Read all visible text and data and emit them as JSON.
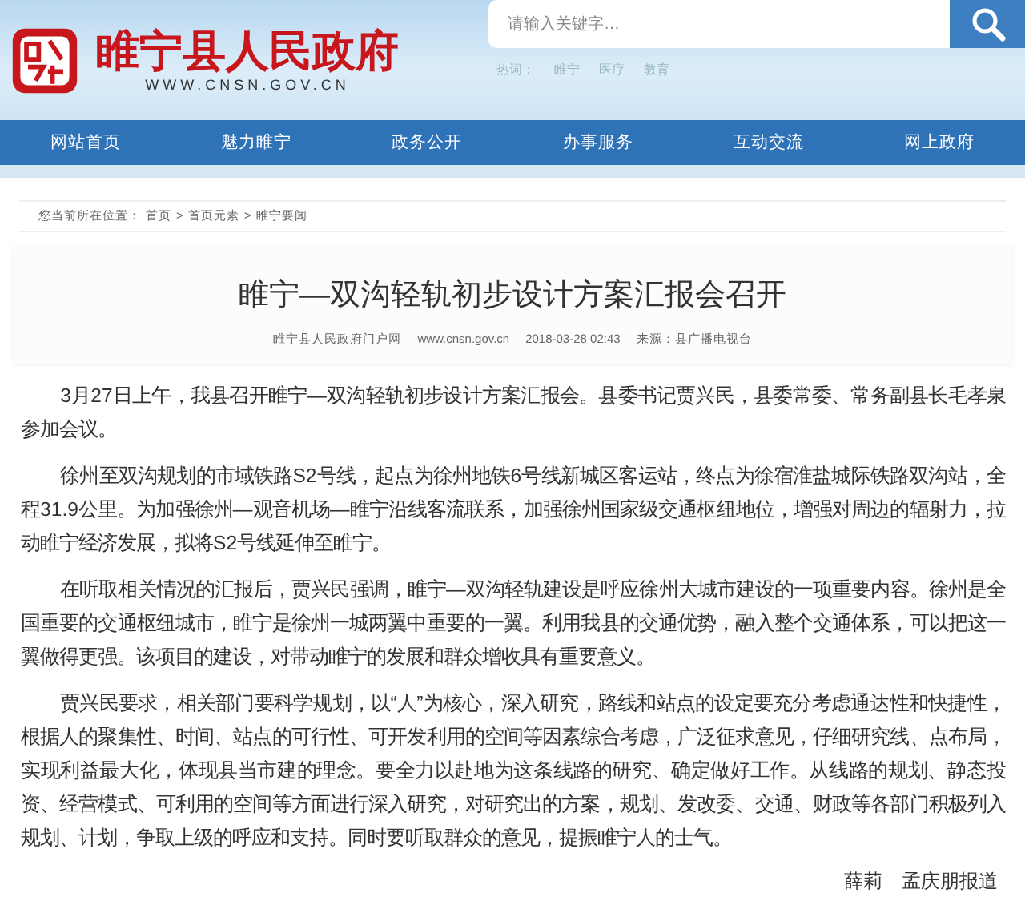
{
  "header": {
    "site_name": "睢宁县人民政府",
    "site_url": "WWW.CNSN.GOV.CN",
    "search": {
      "placeholder": "请输入关键字…"
    },
    "hot_words": {
      "label": "热词：",
      "items": [
        "睢宁",
        "医疗",
        "教育"
      ]
    }
  },
  "nav": [
    {
      "label": "网站首页"
    },
    {
      "label": "魅力睢宁"
    },
    {
      "label": "政务公开"
    },
    {
      "label": "办事服务"
    },
    {
      "label": "互动交流"
    },
    {
      "label": "网上政府"
    }
  ],
  "breadcrumb": {
    "label": "您当前所在位置：",
    "items": [
      "首页",
      "首页元素",
      "睢宁要闻"
    ],
    "separator": ">"
  },
  "article": {
    "title": "睢宁—双沟轻轨初步设计方案汇报会召开",
    "meta": [
      "睢宁县人民政府门户网",
      "www.cnsn.gov.cn",
      "2018-03-28 02:43",
      "来源：县广播电视台"
    ],
    "paragraphs": [
      "3月27日上午，我县召开睢宁—双沟轻轨初步设计方案汇报会。县委书记贾兴民，县委常委、常务副县长毛孝泉参加会议。",
      "徐州至双沟规划的市域铁路S2号线，起点为徐州地铁6号线新城区客运站，终点为徐宿淮盐城际铁路双沟站，全程31.9公里。为加强徐州—观音机场—睢宁沿线客流联系，加强徐州国家级交通枢纽地位，增强对周边的辐射力，拉动睢宁经济发展，拟将S2号线延伸至睢宁。",
      "在听取相关情况的汇报后，贾兴民强调，睢宁—双沟轻轨建设是呼应徐州大城市建设的一项重要内容。徐州是全国重要的交通枢纽城市，睢宁是徐州一城两翼中重要的一翼。利用我县的交通优势，融入整个交通体系，可以把这一翼做得更强。该项目的建设，对带动睢宁的发展和群众增收具有重要意义。",
      "贾兴民要求，相关部门要科学规划，以“人”为核心，深入研究，路线和站点的设定要充分考虑通达性和快捷性，根据人的聚集性、时间、站点的可行性、可开发利用的空间等因素综合考虑，广泛征求意见，仔细研究线、点布局，实现利益最大化，体现县当市建的理念。要全力以赴地为这条线路的研究、确定做好工作。从线路的规划、静态投资、经营模式、可利用的空间等方面进行深入研究，对研究出的方案，规划、发改委、交通、财政等各部门积极列入规划、计划，争取上级的呼应和支持。同时要听取群众的意见，提振睢宁人的士气。"
    ],
    "byline": "薛莉　孟庆朋报道"
  }
}
